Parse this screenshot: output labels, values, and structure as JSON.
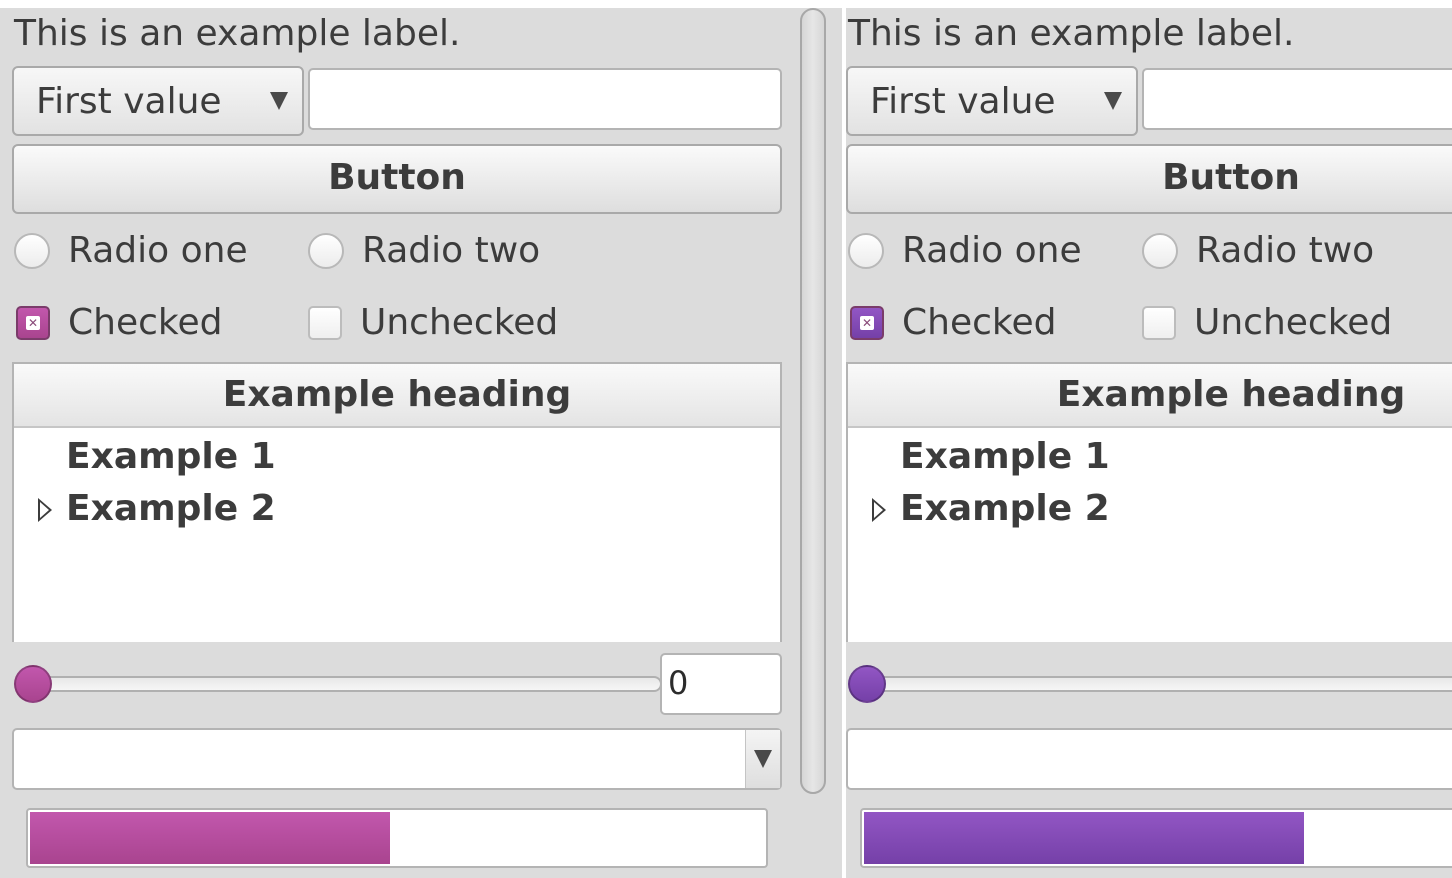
{
  "panes": {
    "left": {
      "label": "This is an example label.",
      "combo_value": "First value",
      "text_entry_value": "",
      "button_label": "Button",
      "radio_one": "Radio one",
      "radio_two": "Radio two",
      "check_checked": "Checked",
      "check_unchecked": "Unchecked",
      "tree_heading": "Example heading",
      "tree_rows": [
        "Example 1",
        "Example 2"
      ],
      "slider_value": "0",
      "combo_entry_value": "",
      "progress_fraction": 0.49,
      "accent_color": "#b54aa1",
      "accent_gradient": [
        "#c257ad",
        "#a9448f"
      ]
    },
    "right": {
      "label": "This is an example label.",
      "combo_value": "First value",
      "text_entry_value": "",
      "button_label": "Button",
      "radio_one": "Radio one",
      "radio_two": "Radio two",
      "check_checked": "Checked",
      "check_unchecked": "Unchecked",
      "tree_heading": "Example heading",
      "tree_rows": [
        "Example 1",
        "Example 2"
      ],
      "combo_entry_value": "",
      "progress_fraction": 0.6,
      "accent_color": "#8347b6",
      "accent_gradient": [
        "#9256c4",
        "#7540a8"
      ]
    }
  },
  "icons": {
    "combo_arrow": "chevron-down-icon",
    "tree_expander": "chevron-right-icon",
    "checkbox_mark": "x-mark-icon"
  }
}
